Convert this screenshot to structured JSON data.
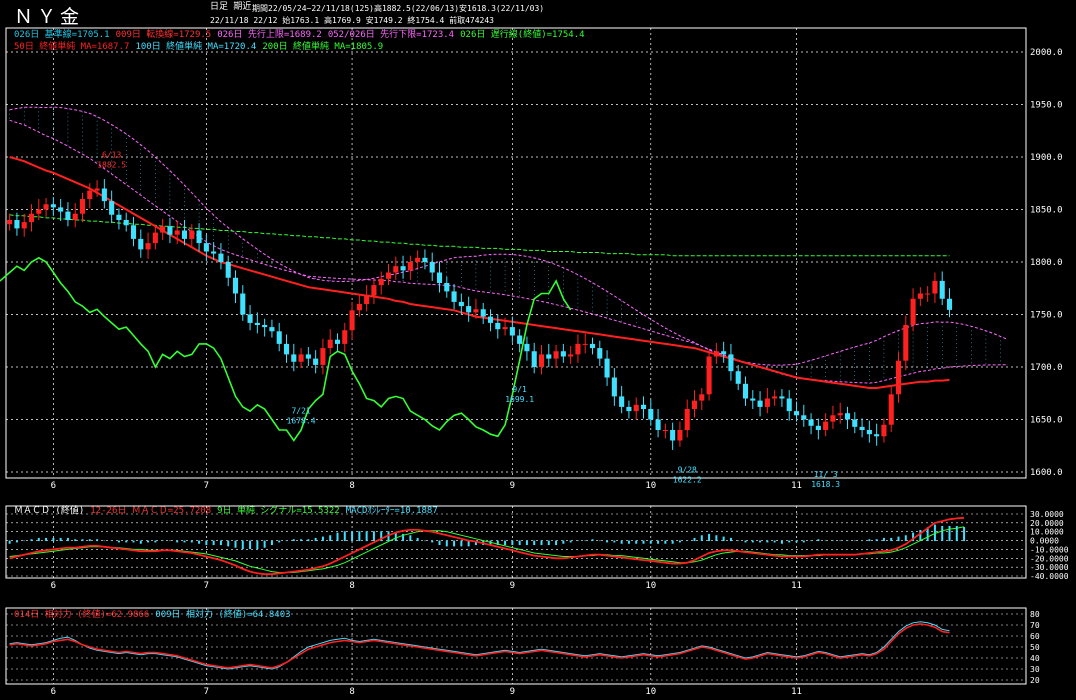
{
  "header": {
    "title": "ＮＹ金",
    "mode": "日足 期近",
    "period_line": "期間22/05/24~22/11/18(125)高1882.5(22/06/13)安1618.3(22/11/03)",
    "ohlc_line": "22/11/18 22/12 始1763.1 高1769.9 安1749.2 終1754.4 前取474243"
  },
  "legend_main": [
    {
      "text": "026日 基準線=1705.1",
      "color": "#1ec8e6"
    },
    {
      "text": "009日 転換線=1729.5",
      "color": "#ff3030"
    },
    {
      "text": "026日 先行上限=1689.2",
      "color": "#ff66ff"
    },
    {
      "text": "052/026日 先行下限=1723.4",
      "color": "#ff66ff"
    },
    {
      "text": "026日 遅行線(終値)=1754.4",
      "color": "#33ff33"
    }
  ],
  "legend_ma": [
    {
      "text": "50日 終値単純 MA=1687.7",
      "color": "#ff2020"
    },
    {
      "text": "100日 終値単純 MA=1720.4",
      "color": "#40e0ff"
    },
    {
      "text": "200日 終値単純 MA=1805.9",
      "color": "#33ff33"
    }
  ],
  "macd_legend": [
    {
      "text": "ＭＡＣＤ (終値)",
      "color": "#ffffff"
    },
    {
      "text": "12-26日 ＭＡＣＤ=25.7208",
      "color": "#ff3030"
    },
    {
      "text": "9日 単純 シグナル=15.5322",
      "color": "#33ff33"
    },
    {
      "text": "MACDｵｼﾚｰﾀｰ=10.1887",
      "color": "#40e0ff"
    }
  ],
  "rsi_legend": [
    {
      "text": "014日 相対力 (終値)=62.9866",
      "color": "#ff3030"
    },
    {
      "text": "009日 相対力 (終値)=64.8403",
      "color": "#40e0ff"
    }
  ],
  "colors": {
    "up": "#ff2020",
    "down": "#40e0ff",
    "grid": "#ffffff",
    "chikou": "#33ff33",
    "span": "#ff66ff"
  },
  "chart_data": [
    {
      "type": "candlestick",
      "ylim": [
        1600,
        2000
      ],
      "yticks": [
        "2000.0",
        "1950.0",
        "1900.0",
        "1850.0",
        "1800.0",
        "1750.0",
        "1700.0",
        "1650.0",
        "1600.0"
      ],
      "month_labels": [
        "6",
        "7",
        "8",
        "9",
        "10",
        "11"
      ],
      "annotations": [
        {
          "label": "6/13",
          "value": "1882.5"
        },
        {
          "label": "7/21",
          "value": "1678.4"
        },
        {
          "label": "9/1",
          "value": "1699.1"
        },
        {
          "label": "9/28",
          "value": "1622.2"
        },
        {
          "label": "11/ 3",
          "value": "1618.3"
        }
      ],
      "close": [
        1840,
        1832,
        1838,
        1846,
        1850,
        1855,
        1852,
        1848,
        1840,
        1846,
        1860,
        1868,
        1870,
        1858,
        1845,
        1840,
        1835,
        1822,
        1812,
        1818,
        1828,
        1834,
        1826,
        1830,
        1822,
        1830,
        1818,
        1810,
        1808,
        1800,
        1785,
        1770,
        1750,
        1742,
        1740,
        1738,
        1734,
        1722,
        1712,
        1705,
        1712,
        1708,
        1702,
        1718,
        1726,
        1722,
        1735,
        1754,
        1760,
        1768,
        1778,
        1784,
        1790,
        1796,
        1792,
        1800,
        1804,
        1800,
        1790,
        1780,
        1772,
        1762,
        1758,
        1752,
        1755,
        1748,
        1742,
        1736,
        1738,
        1730,
        1722,
        1715,
        1700,
        1712,
        1708,
        1715,
        1710,
        1712,
        1722,
        1722,
        1718,
        1708,
        1690,
        1672,
        1662,
        1658,
        1664,
        1660,
        1650,
        1640,
        1640,
        1630,
        1640,
        1660,
        1668,
        1674,
        1710,
        1715,
        1712,
        1696,
        1684,
        1670,
        1668,
        1662,
        1670,
        1672,
        1670,
        1658,
        1654,
        1650,
        1644,
        1640,
        1648,
        1654,
        1656,
        1650,
        1643,
        1640,
        1636,
        1634,
        1645,
        1674,
        1706,
        1740,
        1765,
        1770,
        1770,
        1782,
        1765,
        1754.4
      ],
      "ma50": [
        1900,
        1898,
        1896,
        1893,
        1890,
        1887,
        1885,
        1882,
        1879,
        1876,
        1873,
        1870,
        1866,
        1862,
        1858,
        1854,
        1850,
        1846,
        1842,
        1838,
        1834,
        1830,
        1826,
        1822,
        1818,
        1814,
        1810,
        1806,
        1803,
        1800,
        1798,
        1796,
        1794,
        1792,
        1790,
        1788,
        1786,
        1784,
        1782,
        1780,
        1778,
        1776,
        1775,
        1774,
        1773,
        1772,
        1771,
        1770,
        1769,
        1768,
        1767,
        1766,
        1765,
        1763,
        1762,
        1760,
        1759,
        1758,
        1757,
        1756,
        1755,
        1754,
        1752,
        1750,
        1748,
        1747,
        1746,
        1745,
        1744,
        1743,
        1742,
        1741,
        1740,
        1739,
        1738,
        1737,
        1736,
        1735,
        1734,
        1733,
        1732,
        1731,
        1730,
        1729,
        1728,
        1727,
        1726,
        1725,
        1724,
        1723,
        1722,
        1721,
        1720,
        1719,
        1718,
        1716,
        1714,
        1712,
        1710,
        1708,
        1706,
        1704,
        1702,
        1700,
        1698,
        1696,
        1694,
        1692,
        1690,
        1689,
        1688,
        1687,
        1686,
        1685,
        1684,
        1683,
        1682,
        1681,
        1680,
        1680,
        1681,
        1682,
        1683,
        1684,
        1685,
        1686,
        1686,
        1687,
        1687,
        1687.7
      ],
      "ma200": [
        1845,
        1844,
        1844,
        1843,
        1843,
        1842,
        1842,
        1841,
        1841,
        1840,
        1840,
        1839,
        1839,
        1838,
        1838,
        1837,
        1837,
        1836,
        1836,
        1835,
        1835,
        1834,
        1834,
        1833,
        1833,
        1832,
        1832,
        1831,
        1831,
        1830,
        1830,
        1829,
        1829,
        1828,
        1828,
        1827,
        1827,
        1826,
        1826,
        1825,
        1825,
        1824,
        1824,
        1823,
        1823,
        1822,
        1822,
        1821,
        1821,
        1820,
        1820,
        1819,
        1819,
        1818,
        1818,
        1817,
        1817,
        1816,
        1816,
        1815,
        1815,
        1815,
        1814,
        1814,
        1814,
        1813,
        1813,
        1813,
        1812,
        1812,
        1812,
        1811,
        1811,
        1811,
        1810,
        1810,
        1810,
        1810,
        1809,
        1809,
        1809,
        1809,
        1808,
        1808,
        1808,
        1808,
        1807,
        1807,
        1807,
        1807,
        1807,
        1806,
        1806,
        1806,
        1806,
        1806,
        1806,
        1806,
        1806,
        1806,
        1806,
        1806,
        1806,
        1806,
        1806,
        1806,
        1806,
        1806,
        1806,
        1806,
        1806,
        1806,
        1806,
        1806,
        1806,
        1806,
        1806,
        1806,
        1806,
        1806,
        1806,
        1806,
        1806,
        1806,
        1806,
        1806,
        1806,
        1806,
        1806,
        1805.9
      ]
    },
    {
      "type": "line",
      "title": "MACD",
      "ylim": [
        -40,
        30
      ],
      "yticks": [
        "30.0000",
        "20.0000",
        "10.0000",
        "0.0000",
        "-10.0000",
        "-20.0000",
        "-30.0000",
        "-40.0000"
      ],
      "macd": [
        -20,
        -18,
        -16,
        -14,
        -12,
        -11,
        -10,
        -9,
        -8,
        -8,
        -7,
        -6,
        -6,
        -7,
        -8,
        -9,
        -10,
        -11,
        -12,
        -12,
        -12,
        -11,
        -11,
        -12,
        -13,
        -14,
        -16,
        -18,
        -20,
        -22,
        -25,
        -28,
        -32,
        -35,
        -37,
        -38,
        -38,
        -37,
        -36,
        -35,
        -34,
        -33,
        -31,
        -29,
        -26,
        -22,
        -18,
        -14,
        -10,
        -6,
        -2,
        2,
        6,
        9,
        11,
        12,
        12,
        11,
        10,
        8,
        6,
        4,
        2,
        0,
        -1,
        -3,
        -5,
        -7,
        -9,
        -11,
        -13,
        -15,
        -17,
        -18,
        -19,
        -20,
        -20,
        -19,
        -18,
        -17,
        -16,
        -16,
        -17,
        -18,
        -19,
        -20,
        -21,
        -22,
        -23,
        -24,
        -25,
        -26,
        -26,
        -25,
        -22,
        -18,
        -14,
        -12,
        -11,
        -11,
        -12,
        -13,
        -14,
        -15,
        -16,
        -17,
        -18,
        -18,
        -18,
        -18,
        -17,
        -16,
        -16,
        -16,
        -16,
        -16,
        -16,
        -15,
        -14,
        -13,
        -12,
        -11,
        -8,
        -4,
        2,
        8,
        14,
        20,
        22,
        24,
        25,
        25.72
      ],
      "signal": [
        -18,
        -17,
        -16,
        -15,
        -14,
        -13,
        -12,
        -11,
        -10,
        -9,
        -8,
        -7,
        -7,
        -7,
        -8,
        -8,
        -9,
        -10,
        -10,
        -11,
        -11,
        -11,
        -11,
        -11,
        -12,
        -13,
        -14,
        -15,
        -17,
        -19,
        -21,
        -23,
        -26,
        -29,
        -31,
        -33,
        -35,
        -36,
        -36,
        -36,
        -35,
        -34,
        -33,
        -32,
        -30,
        -28,
        -25,
        -21,
        -17,
        -13,
        -9,
        -5,
        -1,
        3,
        6,
        8,
        10,
        11,
        11,
        11,
        10,
        8,
        6,
        4,
        2,
        0,
        -2,
        -4,
        -6,
        -8,
        -10,
        -12,
        -14,
        -15,
        -16,
        -17,
        -18,
        -18,
        -18,
        -17,
        -17,
        -16,
        -16,
        -17,
        -17,
        -18,
        -19,
        -20,
        -21,
        -22,
        -23,
        -24,
        -25,
        -25,
        -24,
        -22,
        -19,
        -16,
        -14,
        -13,
        -12,
        -12,
        -13,
        -14,
        -15,
        -16,
        -16,
        -17,
        -17,
        -17,
        -17,
        -17,
        -16,
        -16,
        -16,
        -16,
        -16,
        -15,
        -15,
        -14,
        -14,
        -13,
        -11,
        -8,
        -4,
        0,
        4,
        8,
        11,
        13,
        14,
        15.53
      ]
    },
    {
      "type": "line",
      "title": "RSI",
      "ylim": [
        20,
        80
      ],
      "yticks": [
        "80",
        "70",
        "60",
        "50",
        "40",
        "30",
        "20"
      ],
      "rsi14": [
        52,
        53,
        52,
        51,
        52,
        53,
        55,
        56,
        57,
        55,
        52,
        50,
        48,
        47,
        46,
        45,
        46,
        45,
        44,
        45,
        45,
        44,
        43,
        42,
        40,
        38,
        36,
        34,
        33,
        32,
        31,
        32,
        33,
        34,
        33,
        32,
        31,
        33,
        36,
        40,
        44,
        48,
        50,
        52,
        54,
        55,
        56,
        55,
        54,
        55,
        56,
        55,
        54,
        53,
        52,
        51,
        50,
        49,
        48,
        47,
        46,
        45,
        44,
        43,
        42,
        43,
        44,
        45,
        46,
        45,
        44,
        45,
        46,
        47,
        46,
        45,
        44,
        43,
        42,
        41,
        42,
        43,
        42,
        41,
        40,
        41,
        42,
        43,
        42,
        41,
        42,
        43,
        44,
        46,
        48,
        50,
        49,
        47,
        45,
        43,
        41,
        39,
        40,
        42,
        44,
        43,
        42,
        41,
        40,
        41,
        43,
        45,
        44,
        42,
        40,
        41,
        42,
        43,
        42,
        44,
        48,
        55,
        62,
        67,
        70,
        71,
        70,
        68,
        64,
        62.99
      ],
      "rsi9": [
        53,
        54,
        53,
        52,
        53,
        54,
        56,
        58,
        59,
        56,
        52,
        49,
        47,
        46,
        45,
        44,
        45,
        44,
        43,
        44,
        44,
        43,
        42,
        41,
        39,
        37,
        35,
        33,
        32,
        31,
        30,
        31,
        32,
        33,
        32,
        31,
        30,
        32,
        36,
        41,
        46,
        50,
        52,
        54,
        56,
        57,
        58,
        56,
        55,
        56,
        57,
        56,
        55,
        54,
        53,
        52,
        51,
        50,
        49,
        48,
        47,
        46,
        45,
        44,
        43,
        44,
        45,
        46,
        47,
        46,
        45,
        46,
        47,
        48,
        47,
        46,
        45,
        44,
        43,
        42,
        43,
        44,
        43,
        42,
        41,
        42,
        43,
        44,
        43,
        42,
        43,
        44,
        45,
        47,
        49,
        51,
        50,
        48,
        46,
        44,
        42,
        40,
        41,
        43,
        45,
        44,
        43,
        42,
        41,
        42,
        44,
        46,
        45,
        43,
        41,
        42,
        43,
        44,
        43,
        45,
        50,
        57,
        64,
        69,
        72,
        73,
        72,
        70,
        66,
        64.84
      ]
    }
  ]
}
